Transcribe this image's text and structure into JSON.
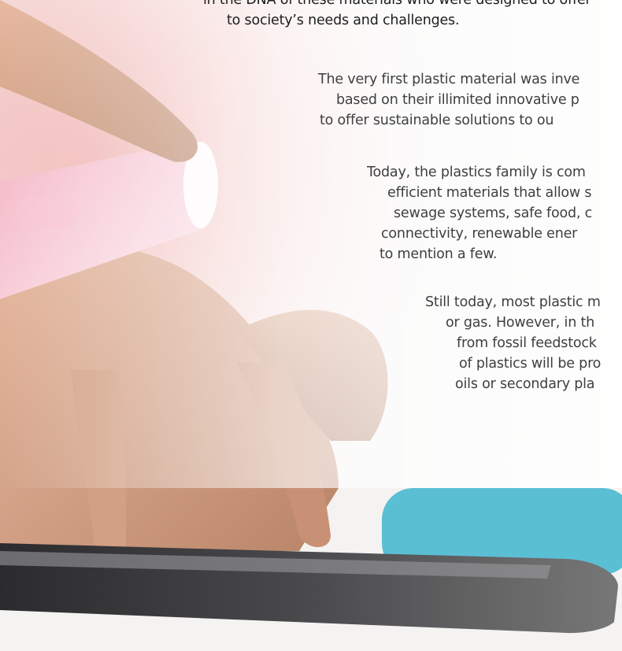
{
  "intro": {
    "lines": [
      "in the DNA of these materials who were designed to offer",
      "to society’s needs and challenges."
    ]
  },
  "paragraph1": {
    "lines": [
      "The very first plastic material was inve",
      "based on their illimited innovative p",
      "to offer sustainable solutions to ou"
    ]
  },
  "paragraph2": {
    "lines": [
      "Today, the plastics family is com",
      "efficient materials that allow s",
      "sewage systems, safe food, c",
      "connectivity, renewable ener",
      "to mention a few."
    ]
  },
  "paragraph3": {
    "lines": [
      "Still today, most plastic m",
      "or gas. However, in th",
      "from fossil feedstock",
      "of plastics will be pro",
      "oils or secondary pla"
    ]
  }
}
